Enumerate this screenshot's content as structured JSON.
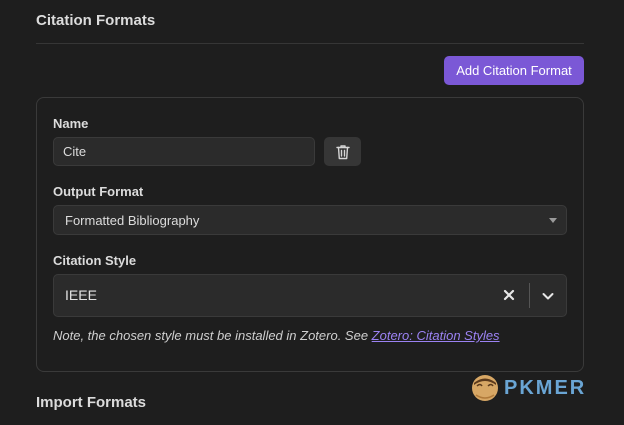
{
  "citation_formats": {
    "title": "Citation Formats",
    "add_button_label": "Add Citation Format",
    "name_label": "Name",
    "name_value": "Cite",
    "output_format_label": "Output Format",
    "output_format_value": "Formatted Bibliography",
    "citation_style_label": "Citation Style",
    "citation_style_value": "IEEE",
    "note_text": "Note, the chosen style must be installed in Zotero. See ",
    "note_link_text": "Zotero: Citation Styles"
  },
  "import_formats": {
    "title": "Import Formats"
  },
  "watermark": {
    "text": "PKMER"
  },
  "colors": {
    "accent": "#7b58d6",
    "link": "#9b82f3",
    "background": "#1e1e1e"
  },
  "icons": {
    "delete": "trash-icon",
    "clear": "close-icon",
    "expand": "chevron-down-icon"
  }
}
